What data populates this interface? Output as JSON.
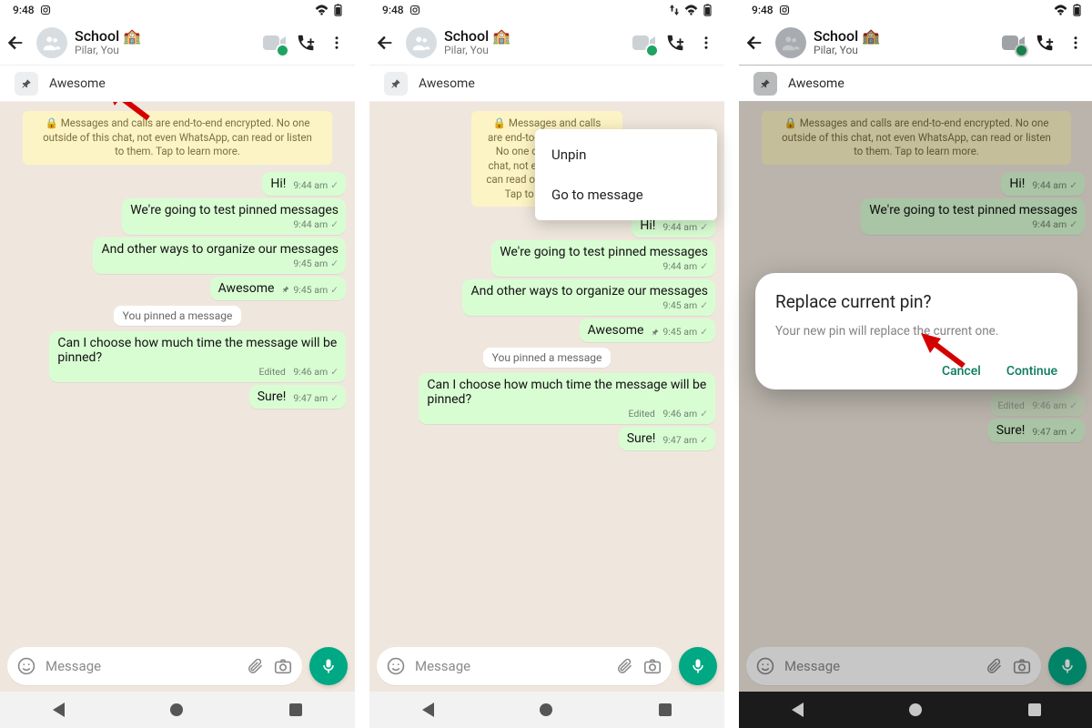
{
  "status": {
    "time": "9:48",
    "time3": "9:48"
  },
  "header": {
    "title": "School 🏫",
    "subtitle": "Pilar, You"
  },
  "pinned": {
    "text": "Awesome"
  },
  "encryption": "🔒 Messages and calls are end-to-end encrypted. No one outside of this chat, not even WhatsApp, can read or listen to them. Tap to learn more.",
  "encryption_short": "🔒 Messages and calls are end-to-end\nencrypted. No one outside of this\nchat, not even WhatsApp, can read or listen to\nthem. Tap to\nlea",
  "msgs": {
    "hi": {
      "text": "Hi!",
      "time": "9:44 am"
    },
    "test": {
      "text": "We're going to test pinned messages",
      "time": "9:44 am"
    },
    "organize": {
      "text": "And other ways to organize our messages",
      "time": "9:45 am"
    },
    "awesome": {
      "text": "Awesome",
      "time": "9:45 am"
    },
    "choose": {
      "text": "Can I choose how much time the message will be pinned?",
      "time": "9:46 am",
      "edited": "Edited"
    },
    "sure": {
      "text": "Sure!",
      "time": "9:47 am"
    }
  },
  "sys": {
    "pinned": "You pinned a message"
  },
  "input": {
    "placeholder": "Message"
  },
  "popup": {
    "unpin": "Unpin",
    "goto": "Go to message"
  },
  "dialog": {
    "title": "Replace current pin?",
    "body": "Your new pin will replace the current one.",
    "cancel": "Cancel",
    "continue": "Continue"
  }
}
